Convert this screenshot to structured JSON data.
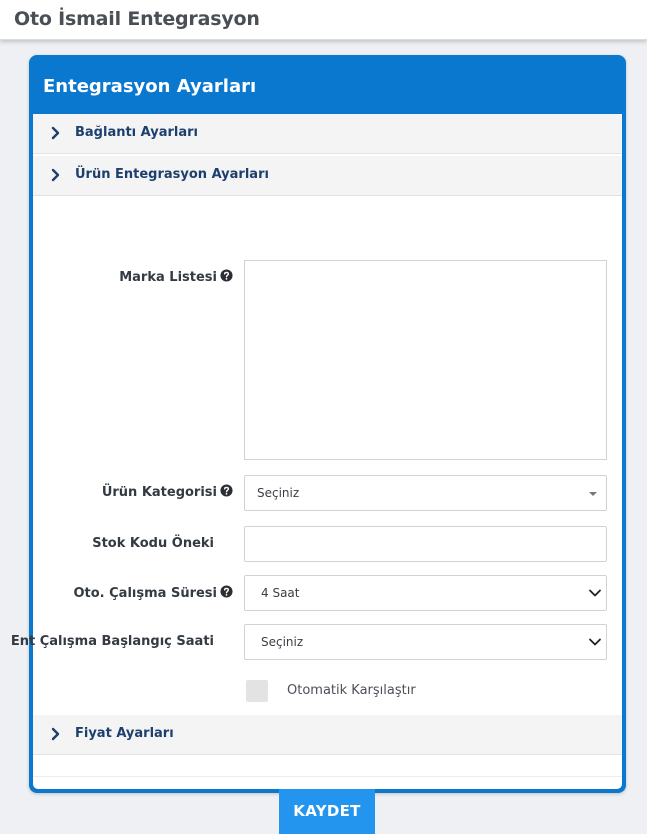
{
  "page": {
    "title": "Oto İsmail Entegrasyon"
  },
  "panel": {
    "title": "Entegrasyon Ayarları"
  },
  "accordion": {
    "connection": "Bağlantı Ayarları",
    "product": "Ürün Entegrasyon Ayarları",
    "price": "Fiyat Ayarları"
  },
  "form": {
    "brand_list_label": "Marka Listesi",
    "brand_list_value": "",
    "category_label": "Ürün Kategorisi",
    "category_value": "Seçiniz",
    "stock_prefix_label": "Stok Kodu Öneki",
    "stock_prefix_value": "",
    "auto_run_label": "Oto. Çalışma Süresi",
    "auto_run_value": "4 Saat",
    "start_time_label": "Ent Çalışma Başlangıç Saati",
    "start_time_value": "Seçiniz",
    "auto_compare_label": "Otomatik Karşılaştır",
    "auto_compare_checked": false
  },
  "actions": {
    "save_label": "KAYDET"
  },
  "colors": {
    "accent": "#0a78cf",
    "button": "#2395ee",
    "accordion_text": "#1d3f6e"
  }
}
